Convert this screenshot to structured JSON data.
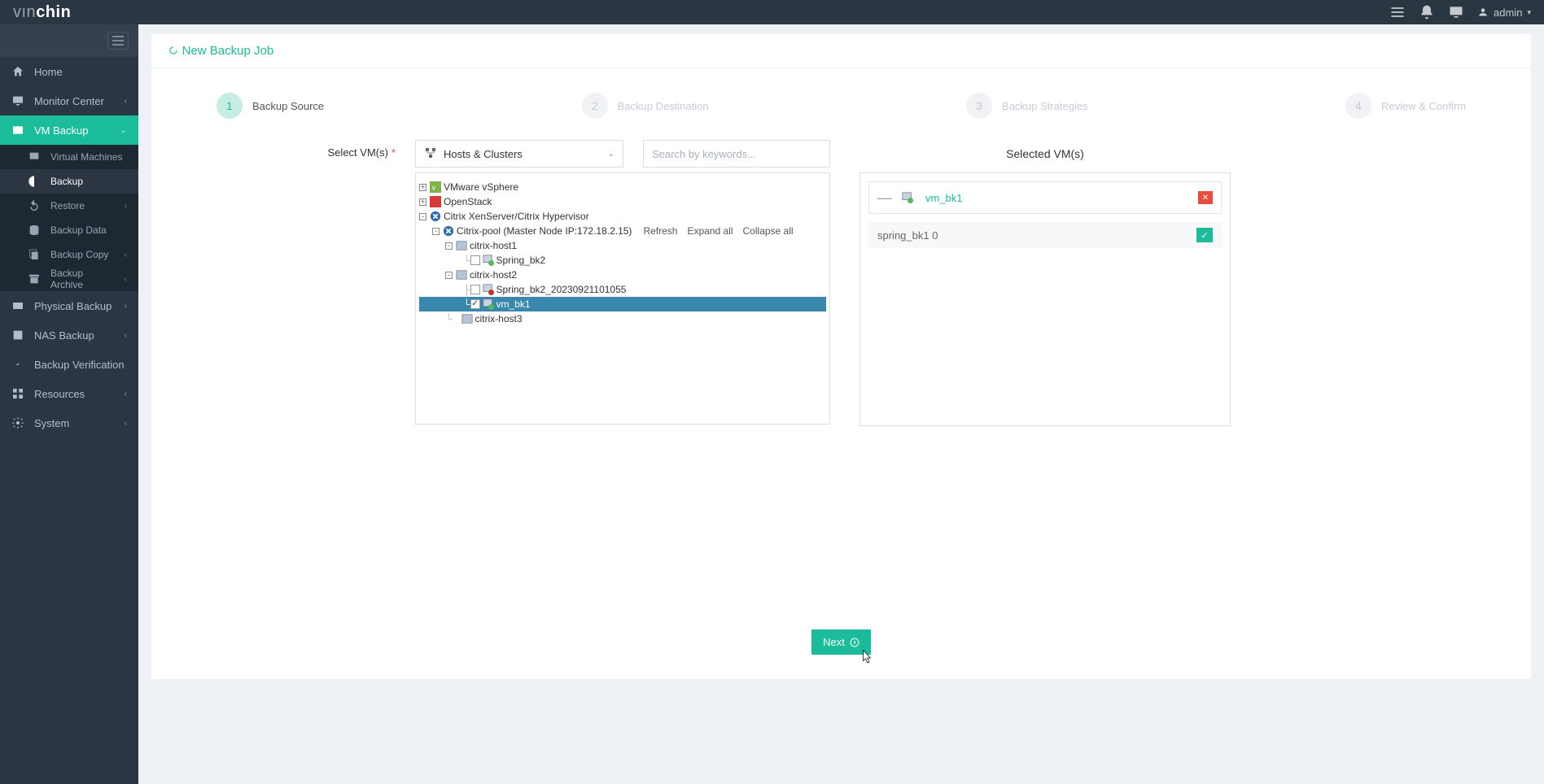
{
  "brand": {
    "p1": "vın",
    "p2": "chin"
  },
  "topbar": {
    "user": "admin"
  },
  "sidebar": {
    "toggle_name": "sidebar-toggle",
    "items": [
      {
        "label": "Home"
      },
      {
        "label": "Monitor Center"
      },
      {
        "label": "VM Backup"
      },
      {
        "label": "Physical Backup"
      },
      {
        "label": "NAS Backup"
      },
      {
        "label": "Backup Verification"
      },
      {
        "label": "Resources"
      },
      {
        "label": "System"
      }
    ],
    "vm_sub": [
      {
        "label": "Virtual Machines"
      },
      {
        "label": "Backup"
      },
      {
        "label": "Restore"
      },
      {
        "label": "Backup Data"
      },
      {
        "label": "Backup Copy"
      },
      {
        "label": "Backup Archive"
      }
    ]
  },
  "page": {
    "title": "New Backup Job"
  },
  "wizard": {
    "steps": [
      {
        "n": "1",
        "label": "Backup Source"
      },
      {
        "n": "2",
        "label": "Backup Destination"
      },
      {
        "n": "3",
        "label": "Backup Strategies"
      },
      {
        "n": "4",
        "label": "Review & Confirm"
      }
    ]
  },
  "form": {
    "select_label": "Select VM(s)",
    "dropdown": "Hosts & Clusters",
    "search_placeholder": "Search by keywords...",
    "tree_actions": {
      "refresh": "Refresh",
      "expand": "Expand all",
      "collapse": "Collapse all"
    }
  },
  "tree": {
    "vmware": "VMware vSphere",
    "openstack": "OpenStack",
    "citrix": "Citrix XenServer/Citrix Hypervisor",
    "pool": "Citrix-pool (Master Node IP:172.18.2.15)",
    "h1": "citrix-host1",
    "h1v1": "Spring_bk2",
    "h2": "citrix-host2",
    "h2v1": "Spring_bk2_20230921101055",
    "h2v2": "vm_bk1",
    "h3": "citrix-host3"
  },
  "selected": {
    "title": "Selected VM(s)",
    "vm": "vm_bk1",
    "disk": "spring_bk1 0"
  },
  "footer": {
    "next": "Next"
  }
}
